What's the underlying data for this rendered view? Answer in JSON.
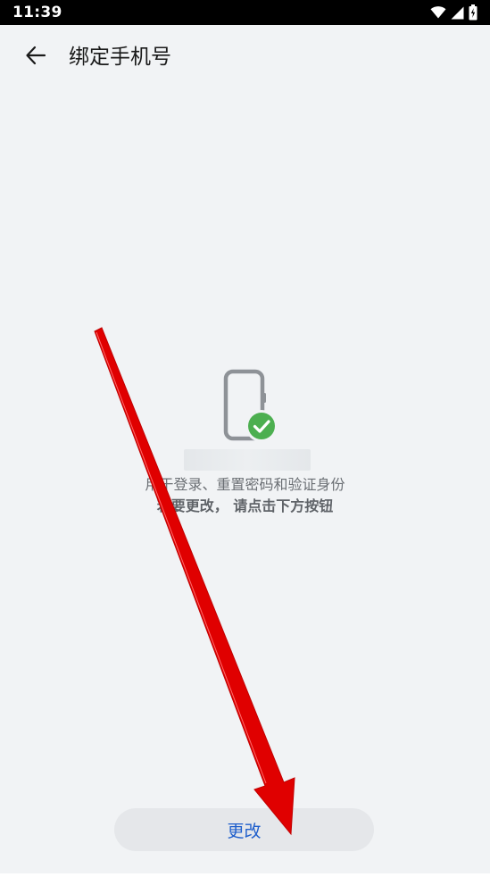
{
  "status_bar": {
    "time": "11:39",
    "icons": [
      "wifi-icon",
      "signal-icon",
      "battery-icon"
    ]
  },
  "header": {
    "back_icon": "arrow-left-icon",
    "title": "绑定手机号"
  },
  "content": {
    "illustration_icon": "phone-check-icon",
    "description": "用于登录、重置密码和验证身份",
    "instruction": "若要更改， 请点击下方按钮"
  },
  "actions": {
    "change_label": "更改"
  },
  "colors": {
    "background": "#f1f3f5",
    "accent": "#1f5fcc",
    "success": "#4caf50",
    "annotation": "#e00000"
  }
}
